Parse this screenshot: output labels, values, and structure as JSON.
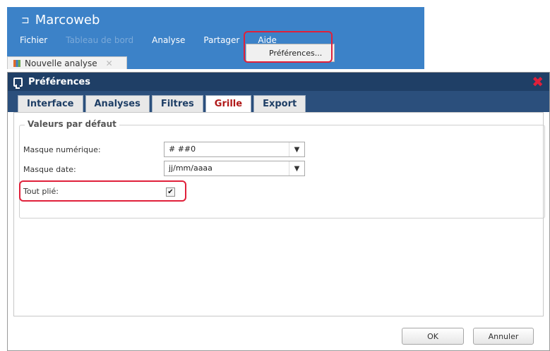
{
  "app": {
    "title": "Marcoweb",
    "menu": [
      "Fichier",
      "Tableau de bord",
      "Analyse",
      "Partager",
      "Aide"
    ],
    "tab_label": "Nouvelle analyse",
    "dropdown_item": "Préférences..."
  },
  "dialog": {
    "title": "Préférences",
    "tabs": [
      "Interface",
      "Analyses",
      "Filtres",
      "Grille",
      "Export"
    ],
    "active_tab": "Grille",
    "fieldset_legend": "Valeurs par défaut",
    "fields": {
      "numeric_mask_label": "Masque numérique:",
      "numeric_mask_value": "# ##0",
      "date_mask_label": "Masque date:",
      "date_mask_value": "jj/mm/aaaa",
      "collapse_all_label": "Tout plié:",
      "collapse_all_checked": true
    },
    "buttons": {
      "ok": "OK",
      "cancel": "Annuler"
    }
  },
  "colors": {
    "header_blue": "#3c82c8",
    "dialog_navy": "#1f3f66",
    "highlight_red": "#e0203a",
    "active_tab_text": "#b01818"
  }
}
